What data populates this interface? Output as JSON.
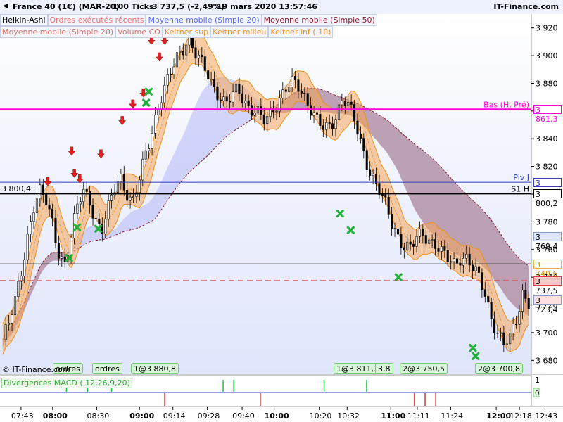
{
  "header": {
    "instrument": "France 40 (1€) (MAR-20)",
    "ticks": "100 Ticks",
    "price": "3 737,5 (-2,49%)",
    "datetime": "19 mars 2020 13:57:46",
    "brand": "IT-Finance.com"
  },
  "legend": [
    {
      "label": "Heikin-Ashi",
      "color": "#000000"
    },
    {
      "label": "Ordres exécutés récents",
      "color": "#f07070"
    },
    {
      "label": "Moyenne mobile (Simple 20)",
      "color": "#5a6cf0"
    },
    {
      "label": "Moyenne mobile (Simple 50)",
      "color": "#8b1a2a"
    },
    {
      "label": "Moyenne mobile (Simple 20)",
      "color": "#e07060"
    },
    {
      "label": "Volume CO",
      "color": "#e07060"
    },
    {
      "label": "Keltner sup",
      "color": "#f0901a"
    },
    {
      "label": "Keltner milieu",
      "color": "#f0901a"
    },
    {
      "label": "Keltner inf (  10)",
      "color": "#f0901a"
    }
  ],
  "copyright": "© IT-Finance.com",
  "macd_label": "Divergences MACD ( 12,26,9,20)",
  "chart_data": {
    "type": "candlestick",
    "title": "",
    "y_ticks": [
      "3 920",
      "3 900",
      "3 880",
      "3 860",
      "3 840",
      "3 820",
      "3 800",
      "3 780",
      "3 760",
      "3 740",
      "3 720",
      "3 700",
      "3 680"
    ],
    "ylim": [
      3670,
      3930
    ],
    "x_ticks": [
      {
        "label": "07:43",
        "bold": false,
        "pos": 0.02
      },
      {
        "label": "08:00",
        "bold": true,
        "pos": 0.09
      },
      {
        "label": "08:30",
        "bold": false,
        "pos": 0.19
      },
      {
        "label": "09:00",
        "bold": true,
        "pos": 0.27
      },
      {
        "label": "09:14",
        "bold": false,
        "pos": 0.36
      },
      {
        "label": "09:28",
        "bold": false,
        "pos": 0.46
      },
      {
        "label": "09:40",
        "bold": false,
        "pos": 0.55
      },
      {
        "label": "10:00",
        "bold": true,
        "pos": 0.65
      },
      {
        "label": "10:20",
        "bold": false,
        "pos": 0.75
      },
      {
        "label": "10:32",
        "bold": false,
        "pos": 0.82
      },
      {
        "label": "11:00",
        "bold": true,
        "pos": 0.91
      },
      {
        "label": "11:11",
        "bold": false,
        "pos": 0.97
      },
      {
        "label": "11:24",
        "bold": false,
        "pos": 1.04
      }
    ],
    "x_labels": [
      "07:43",
      "08:00",
      "08:30",
      "09:00",
      "09:14",
      "09:28",
      "09:40",
      "10:00",
      "10:20",
      "10:32",
      "11:00",
      "11:11",
      "11:24",
      "12:00",
      "12:18",
      "12:43"
    ],
    "x_labels_bold": [
      false,
      true,
      false,
      true,
      false,
      false,
      false,
      true,
      false,
      false,
      true,
      false,
      false,
      true,
      false,
      false
    ],
    "price_path": [
      3695,
      3705,
      3722,
      3745,
      3770,
      3790,
      3800,
      3795,
      3782,
      3760,
      3748,
      3765,
      3790,
      3805,
      3798,
      3780,
      3770,
      3788,
      3806,
      3815,
      3800,
      3790,
      3808,
      3830,
      3845,
      3860,
      3872,
      3885,
      3900,
      3906,
      3912,
      3900,
      3895,
      3890,
      3880,
      3870,
      3862,
      3870,
      3878,
      3870,
      3860,
      3858,
      3852,
      3858,
      3865,
      3870,
      3876,
      3880,
      3878,
      3870,
      3860,
      3850,
      3846,
      3850,
      3860,
      3870,
      3862,
      3850,
      3836,
      3822,
      3810,
      3800,
      3790,
      3778,
      3770,
      3762,
      3760,
      3768,
      3772,
      3768,
      3764,
      3756,
      3752,
      3750,
      3756,
      3754,
      3745,
      3738,
      3728,
      3712,
      3700,
      3690,
      3695,
      3710,
      3730,
      3722
    ],
    "series": [
      {
        "name": "Moyenne mobile (Simple 20)",
        "color": "#5a6cf0"
      },
      {
        "name": "Moyenne mobile (Simple 50)",
        "color": "#8b1a2a"
      },
      {
        "name": "Keltner sup",
        "color": "#f0901a"
      },
      {
        "name": "Keltner milieu",
        "color": "#f0901a"
      },
      {
        "name": "Keltner inf (  10)",
        "color": "#f0901a"
      }
    ],
    "hlines": [
      {
        "label": "Bas (H, Pré)",
        "value": 3861.3,
        "value_label": "3 861,3",
        "color": "#ff00e0",
        "width": 2,
        "dash": false
      },
      {
        "label": "Piv J",
        "value": 3808.6,
        "value_label": "3 808,6",
        "color": "#3040c0",
        "width": 1,
        "dash": false
      },
      {
        "label": "S1 H",
        "value": 3800.2,
        "value_label": "3 800,2",
        "color": "#000000",
        "width": 1.5,
        "dash": false
      },
      {
        "label": "",
        "value": 3749.6,
        "value_label": "3 749,6",
        "color": "#000000",
        "width": 1,
        "dash": false
      },
      {
        "label": "",
        "value": 3737.5,
        "value_label": "3 737,5",
        "color": "#e04040",
        "width": 1.5,
        "dash": true
      }
    ],
    "left_label": "3 800,4",
    "price_boxes": [
      {
        "value": 3769.4,
        "label": "3 769,4",
        "bg": "#dde4ff",
        "color": "#000"
      },
      {
        "value": 3723.4,
        "label": "3 723,4",
        "bg": "#ffe0e0",
        "color": "#000"
      }
    ],
    "orders": [
      {
        "label": "ordres",
        "pos": 0.1
      },
      {
        "label": "ordres",
        "pos": 0.17
      },
      {
        "label": "1@3 880,8",
        "pos": 0.24
      },
      {
        "label": "1@3 811,3",
        "pos": 0.6
      },
      {
        "label": "3,8",
        "pos": 0.67
      },
      {
        "label": "2@3 750,5",
        "pos": 0.72
      },
      {
        "label": "2@3 700,8",
        "pos": 0.85
      }
    ],
    "sell_arrows": [
      [
        0.09,
        3806
      ],
      [
        0.135,
        3828
      ],
      [
        0.14,
        3812
      ],
      [
        0.15,
        3808
      ],
      [
        0.19,
        3826
      ],
      [
        0.23,
        3850
      ],
      [
        0.25,
        3862
      ],
      [
        0.27,
        3870
      ],
      [
        0.285,
        3908
      ],
      [
        0.3,
        3896
      ],
      [
        0.31,
        3908
      ]
    ],
    "buy_marks": [
      [
        0.13,
        3754
      ],
      [
        0.145,
        3776
      ],
      [
        0.185,
        3775
      ],
      [
        0.28,
        3874
      ],
      [
        0.275,
        3866
      ],
      [
        0.64,
        3786
      ],
      [
        0.66,
        3774
      ],
      [
        0.75,
        3740
      ],
      [
        0.89,
        3689
      ],
      [
        0.895,
        3683
      ]
    ],
    "macd_up": [
      0.125,
      0.165,
      0.21,
      0.42,
      0.44,
      0.61,
      0.69
    ],
    "macd_down": [
      0.31,
      0.49,
      0.78,
      0.8,
      0.82
    ]
  }
}
